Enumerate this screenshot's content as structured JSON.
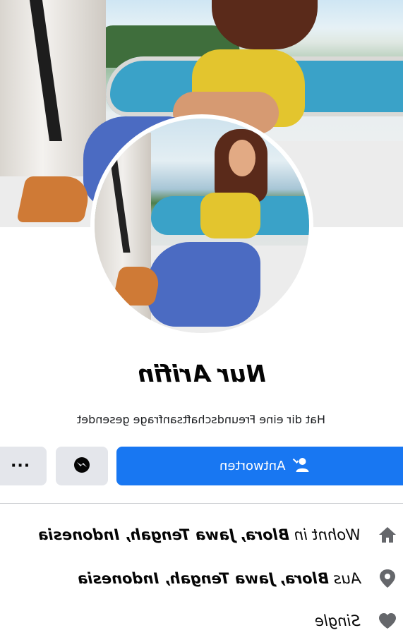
{
  "profile": {
    "name": "Nur Arifin",
    "subtitle": "Hat dir eine Freundschaftsanfrage gesendet"
  },
  "actions": {
    "reply_label": "Antworten",
    "reply_icon": "person-check-icon",
    "messenger_icon": "messenger-icon",
    "more_label": "···"
  },
  "info": {
    "home": {
      "prefix": "Wohnt in",
      "place": "Blora, Jawa Tengah, Indonesia",
      "icon": "home-icon"
    },
    "origin": {
      "prefix": "Aus",
      "place": "Blora, Jawa Tengah, Indonesia",
      "icon": "location-pin-icon"
    },
    "relationship": {
      "status": "Single",
      "icon": "heart-icon"
    }
  },
  "colors": {
    "primary_button": "#1877f2",
    "secondary_button": "#e4e6eb",
    "icon_gray": "#65676b"
  }
}
